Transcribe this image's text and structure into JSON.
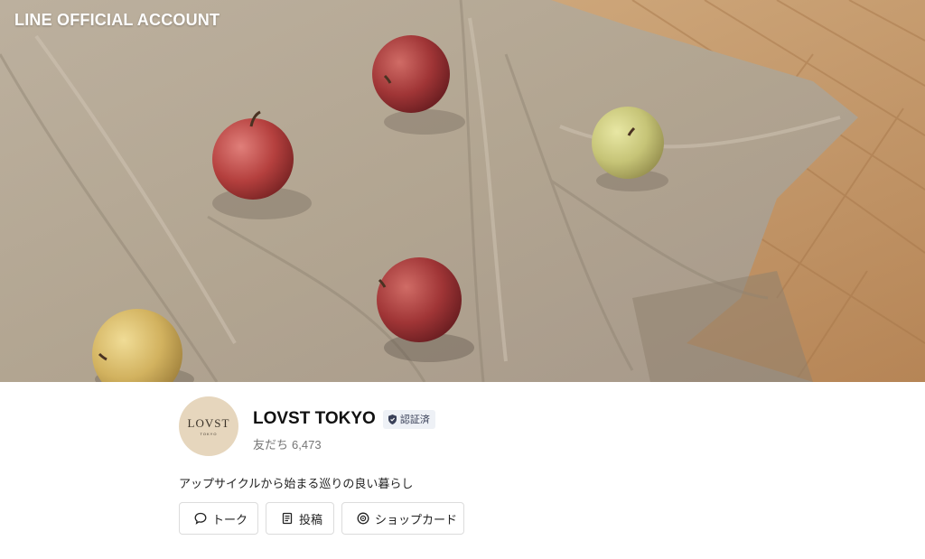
{
  "header": {
    "brand": "LINE OFFICIAL ACCOUNT"
  },
  "cover": {
    "description": "cover-photo"
  },
  "profile": {
    "avatar_text": "LOVST",
    "avatar_subtext": "TOKYO",
    "name": "LOVST TOKYO",
    "verified_label": "認証済",
    "friends_label": "友だち",
    "friends_count": "6,473",
    "description": "アップサイクルから始まる巡りの良い暮らし"
  },
  "actions": {
    "talk": "トーク",
    "posts": "投稿",
    "shop_card": "ショップカード"
  },
  "colors": {
    "verified_bg": "#eef1f6",
    "verified_text": "#394058",
    "avatar_bg": "#e6d6bd",
    "button_border": "#dcdcdc"
  },
  "icons": {
    "talk": "speech-bubble-icon",
    "posts": "document-icon",
    "shop_card": "target-icon",
    "verified": "shield-icon"
  }
}
